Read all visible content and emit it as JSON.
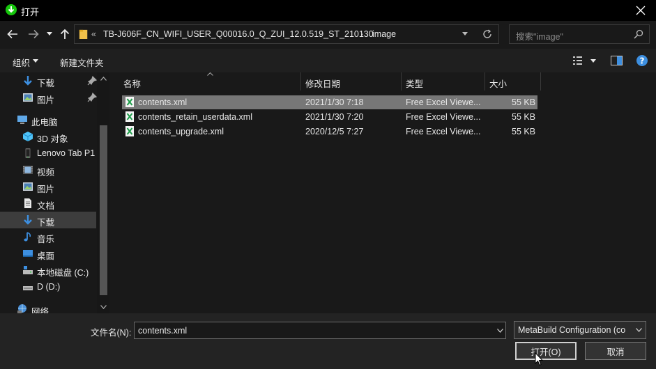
{
  "window": {
    "title": "打开"
  },
  "address": {
    "overflow": "«",
    "crumbs": [
      "TB-J606F_CN_WIFI_USER_Q00016.0_Q_ZUI_12.0.519_ST_210130",
      "image"
    ],
    "separator": "›"
  },
  "search": {
    "placeholder": "搜索\"image\""
  },
  "toolbar": {
    "organize": "组织",
    "new_folder": "新建文件夹"
  },
  "sidebar": {
    "items": [
      {
        "label": "下载",
        "icon": "download-arrow-icon",
        "pinned": true
      },
      {
        "label": "图片",
        "icon": "pictures-icon",
        "pinned": true
      },
      {
        "label": "此电脑",
        "icon": "computer-icon"
      },
      {
        "label": "3D 对象",
        "icon": "3d-objects-icon"
      },
      {
        "label": "Lenovo Tab P1",
        "icon": "tablet-device-icon"
      },
      {
        "label": "视频",
        "icon": "videos-icon"
      },
      {
        "label": "图片",
        "icon": "pictures-icon"
      },
      {
        "label": "文档",
        "icon": "documents-icon"
      },
      {
        "label": "下载",
        "icon": "download-arrow-icon",
        "selected": true
      },
      {
        "label": "音乐",
        "icon": "music-icon"
      },
      {
        "label": "桌面",
        "icon": "desktop-icon"
      },
      {
        "label": "本地磁盘 (C:)",
        "icon": "local-disk-icon"
      },
      {
        "label": "D (D:)",
        "icon": "drive-icon"
      },
      {
        "label": "网络",
        "icon": "network-icon"
      }
    ]
  },
  "columns": {
    "name": "名称",
    "date": "修改日期",
    "type": "类型",
    "size": "大小"
  },
  "files": [
    {
      "name": "contents.xml",
      "date": "2021/1/30 7:18",
      "type": "Free Excel Viewe...",
      "size": "55 KB",
      "selected": true
    },
    {
      "name": "contents_retain_userdata.xml",
      "date": "2021/1/30 7:20",
      "type": "Free Excel Viewe...",
      "size": "55 KB"
    },
    {
      "name": "contents_upgrade.xml",
      "date": "2020/12/5 7:27",
      "type": "Free Excel Viewe...",
      "size": "55 KB"
    }
  ],
  "footer": {
    "filename_label": "文件名(N):",
    "filename_value": "contents.xml",
    "filter_value": "MetaBuild Configuration (co",
    "open_label": "打开(O)",
    "cancel_label": "取消"
  },
  "colors": {
    "accent_blue": "#3d8fe0",
    "title_icon_green": "#16c60c",
    "xml_green": "#1e9e4a",
    "selected_row": "#777777"
  }
}
